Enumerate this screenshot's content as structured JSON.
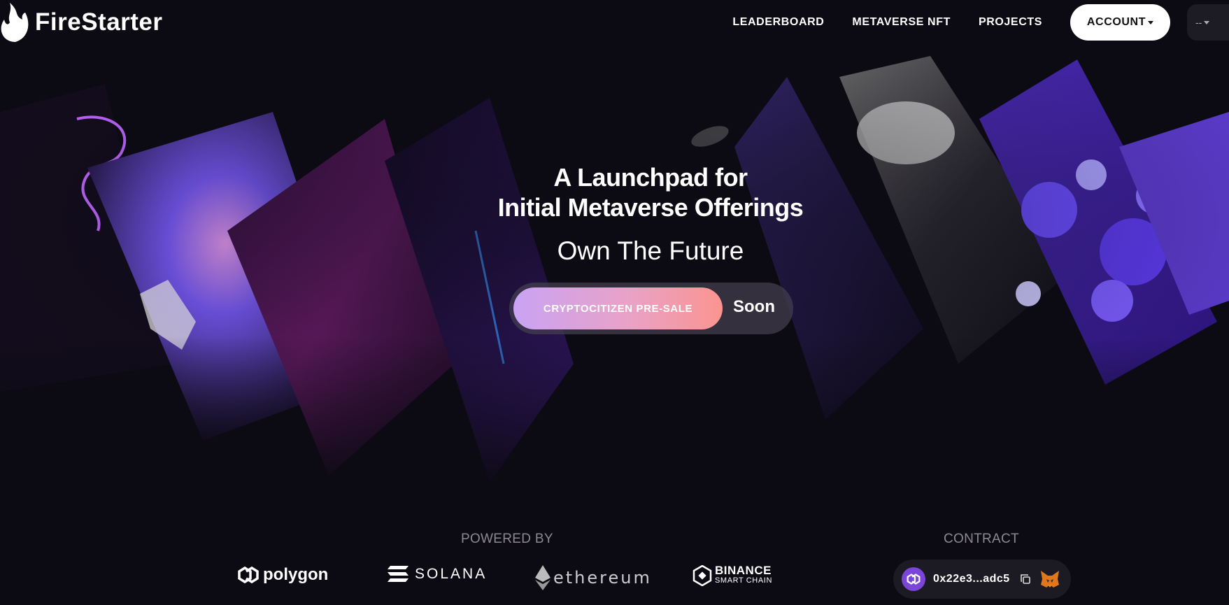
{
  "header": {
    "brand": "FireStarter",
    "nav": [
      "LEADERBOARD",
      "METAVERSE NFT",
      "PROJECTS"
    ],
    "account_label": "ACCOUNT",
    "network_label": "--"
  },
  "hero": {
    "title_line1": "A Launchpad for",
    "title_line2": "Initial Metaverse Offerings",
    "subtitle": "Own The Future",
    "cta_label": "CRYPTOCITIZEN PRE-SALE",
    "cta_status": "Soon"
  },
  "powered": {
    "label": "POWERED BY",
    "partners": [
      {
        "name": "polygon",
        "icon": "polygon-icon"
      },
      {
        "name": "SOLANA",
        "icon": "solana-icon"
      },
      {
        "name": "ethereum",
        "icon": "ethereum-icon"
      },
      {
        "name": "BINANCE",
        "sub": "SMART CHAIN",
        "icon": "binance-icon"
      }
    ]
  },
  "contract": {
    "label": "CONTRACT",
    "address": "0x22e3...adc5",
    "icons": [
      "polygon-icon",
      "copy-icon",
      "metamask-fox-icon"
    ]
  },
  "colors": {
    "background": "#0c0a12",
    "accent_purple": "#7b45d8",
    "cta_gradient_start": "#c9a3f4",
    "cta_gradient_end": "#fb9490"
  }
}
